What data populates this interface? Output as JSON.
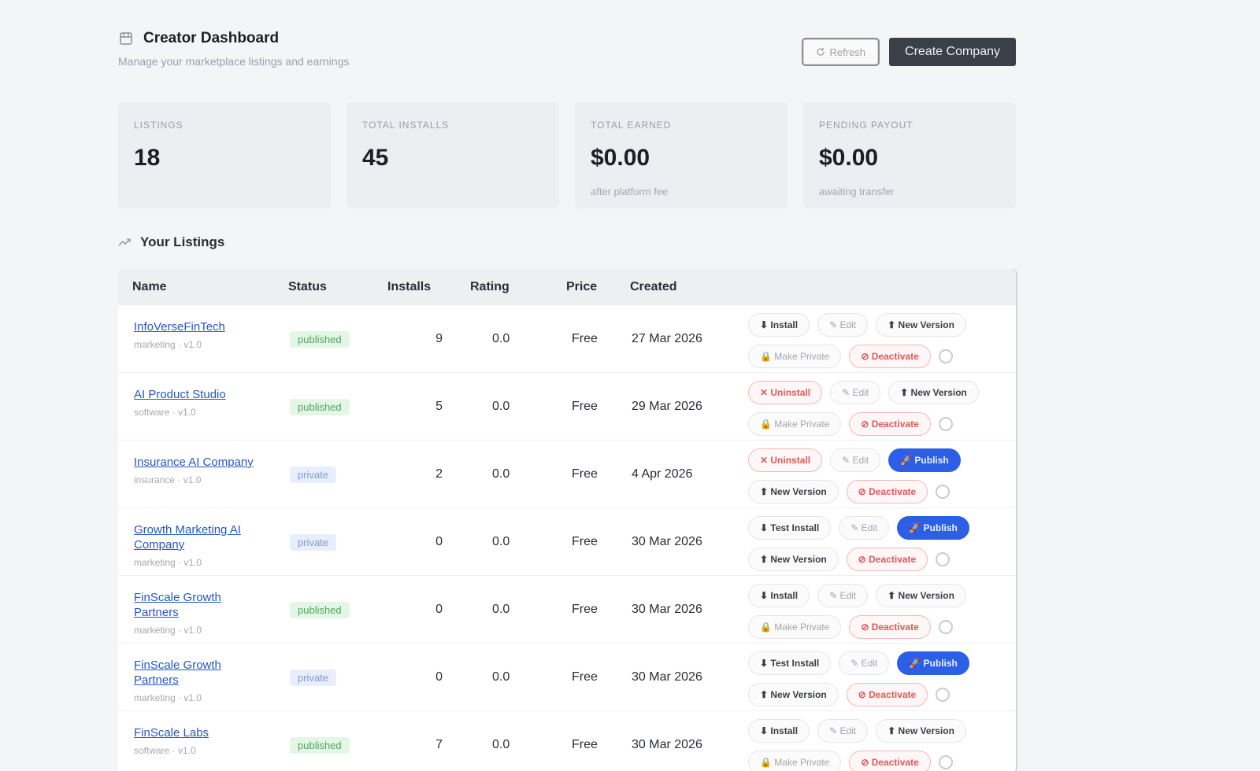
{
  "header": {
    "title": "Creator Dashboard",
    "subtitle": "Manage your marketplace listings and earnings",
    "refresh_label": "Refresh",
    "create_label": "Create Company"
  },
  "stats": [
    {
      "label": "LISTINGS",
      "value": "18",
      "note": ""
    },
    {
      "label": "TOTAL INSTALLS",
      "value": "45",
      "note": ""
    },
    {
      "label": "TOTAL EARNED",
      "value": "$0.00",
      "note": "after platform fee"
    },
    {
      "label": "PENDING PAYOUT",
      "value": "$0.00",
      "note": "awaiting transfer"
    }
  ],
  "section_title": "Your Listings",
  "table": {
    "columns": [
      "Name",
      "Status",
      "Installs",
      "Rating",
      "Price",
      "Created"
    ],
    "rows": [
      {
        "name": "InfoVerseFinTech",
        "meta": "marketing · v1.0",
        "status": "published",
        "installs": "9",
        "rating": "0.0",
        "price": "Free",
        "created": "27 Mar 2026",
        "actions": [
          [
            "⬇ Install",
            "✎ Edit",
            "⬆ New Version"
          ],
          [
            "🔒 Make Private",
            "⊘ Deactivate"
          ]
        ]
      },
      {
        "name": "AI Product Studio",
        "meta": "software · v1.0",
        "status": "published",
        "installs": "5",
        "rating": "0.0",
        "price": "Free",
        "created": "29 Mar 2026",
        "actions": [
          [
            "✕ Uninstall",
            "✎ Edit",
            "⬆ New Version"
          ],
          [
            "🔒 Make Private",
            "⊘ Deactivate"
          ]
        ]
      },
      {
        "name": "Insurance AI Company",
        "meta": "insurance · v1.0",
        "status": "private",
        "installs": "2",
        "rating": "0.0",
        "price": "Free",
        "created": "4 Apr 2026",
        "actions": [
          [
            "✕ Uninstall",
            "✎ Edit",
            "🚀 Publish"
          ],
          [
            "⬆ New Version",
            "⊘ Deactivate"
          ]
        ]
      },
      {
        "name": "Growth Marketing AI Company",
        "meta": "marketing · v1.0",
        "status": "private",
        "installs": "0",
        "rating": "0.0",
        "price": "Free",
        "created": "30 Mar 2026",
        "actions": [
          [
            "⬇ Test Install",
            "✎ Edit",
            "🚀 Publish"
          ],
          [
            "⬆ New Version",
            "⊘ Deactivate"
          ]
        ]
      },
      {
        "name": "FinScale Growth Partners",
        "meta": "marketing · v1.0",
        "status": "published",
        "installs": "0",
        "rating": "0.0",
        "price": "Free",
        "created": "30 Mar 2026",
        "actions": [
          [
            "⬇ Install",
            "✎ Edit",
            "⬆ New Version"
          ],
          [
            "🔒 Make Private",
            "⊘ Deactivate"
          ]
        ]
      },
      {
        "name": "FinScale Growth Partners",
        "meta": "marketing · v1.0",
        "status": "private",
        "installs": "0",
        "rating": "0.0",
        "price": "Free",
        "created": "30 Mar 2026",
        "actions": [
          [
            "⬇ Test Install",
            "✎ Edit",
            "🚀 Publish"
          ],
          [
            "⬆ New Version",
            "⊘ Deactivate"
          ]
        ]
      },
      {
        "name": "FinScale Labs",
        "meta": "software · v1.0",
        "status": "published",
        "installs": "7",
        "rating": "0.0",
        "price": "Free",
        "created": "30 Mar 2026",
        "actions": [
          [
            "⬇ Install",
            "✎ Edit",
            "⬆ New Version"
          ],
          [
            "🔒 Make Private",
            "⊘ Deactivate"
          ]
        ]
      }
    ]
  }
}
